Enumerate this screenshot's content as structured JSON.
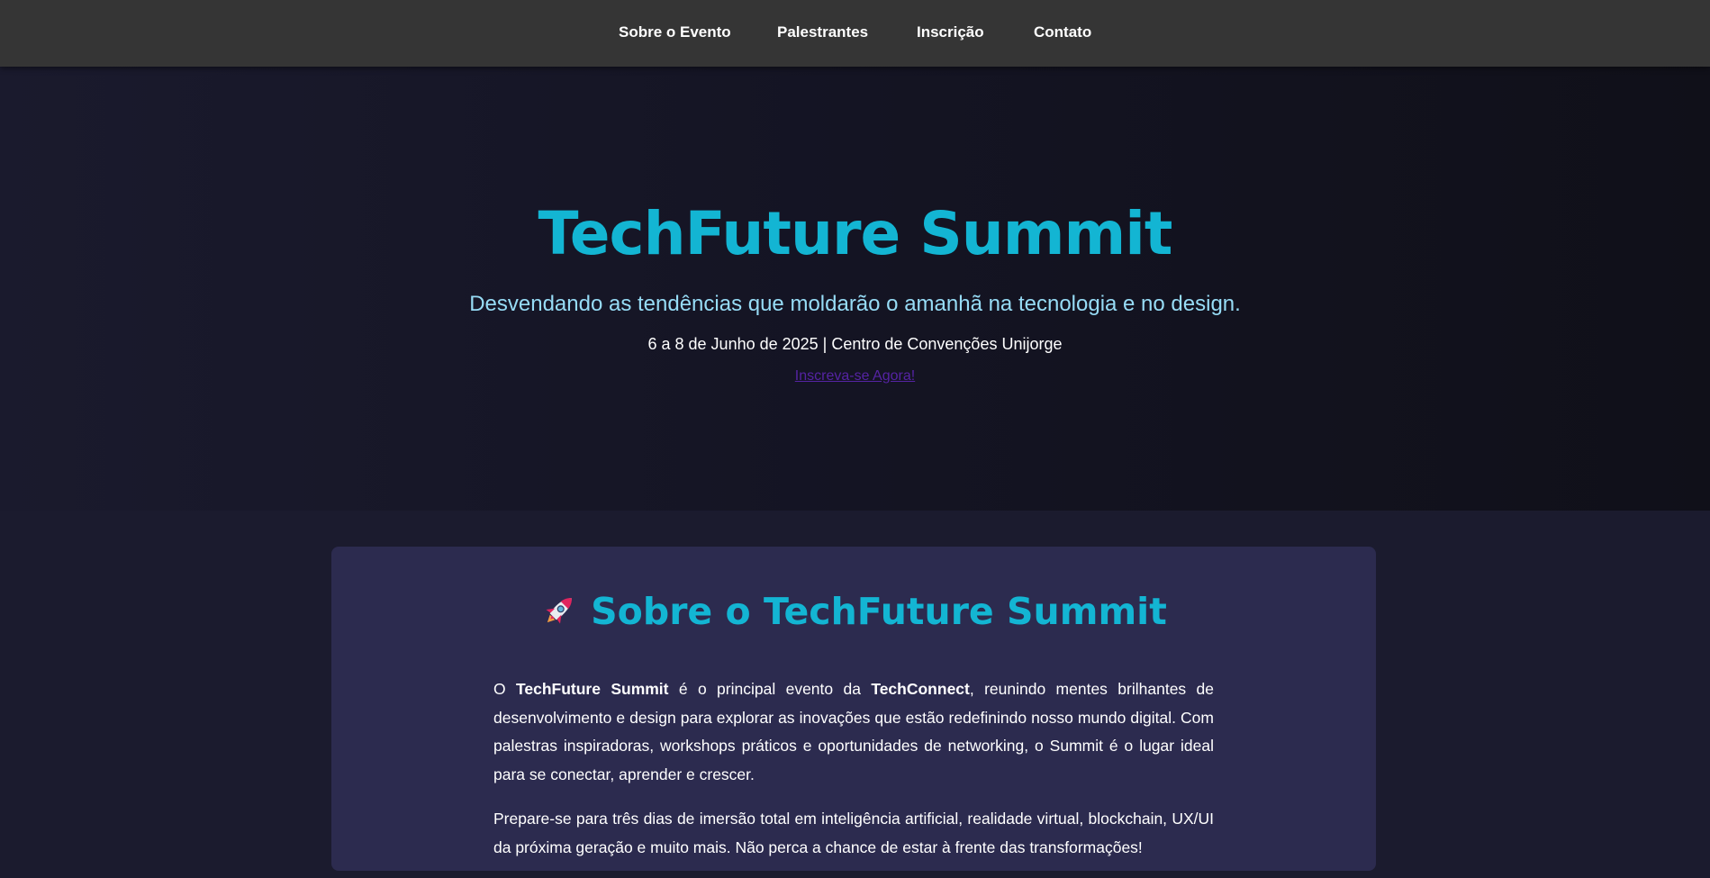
{
  "nav": {
    "items": [
      {
        "label": "Sobre o Evento"
      },
      {
        "label": "Palestrantes"
      },
      {
        "label": "Inscrição"
      },
      {
        "label": "Contato"
      }
    ]
  },
  "hero": {
    "title": "TechFuture Summit",
    "subtitle": "Desvendando as tendências que moldarão o amanhã na tecnologia e no design.",
    "date_location": "6 a 8 de Junho de 2025 | Centro de Convenções Unijorge",
    "cta": "Inscreva-se Agora!"
  },
  "about": {
    "icon": "rocket-icon",
    "title": "Sobre o TechFuture Summit",
    "p1": {
      "pre": "O ",
      "strong1": "TechFuture Summit",
      "mid": " é o principal evento da ",
      "strong2": "TechConnect",
      "post": ", reunindo mentes brilhantes de desenvolvimento e design para explorar as inovações que estão redefinindo nosso mundo digital. Com palestras inspiradoras, workshops práticos e oportunidades de networking, o Summit é o lugar ideal para se conectar, aprender e crescer."
    },
    "p2": "Prepare-se para três dias de imersão total em inteligência artificial, realidade virtual, blockchain, UX/UI da próxima geração e muito mais. Não perca a chance de estar à frente das transformações!"
  },
  "colors": {
    "navbar_bg": "#353535",
    "page_bg": "#1b1b2e",
    "accent": "#13b5d3",
    "subtitle": "#97dcf6",
    "card_bg": "#2c2b4f",
    "link": "#5523a3"
  }
}
